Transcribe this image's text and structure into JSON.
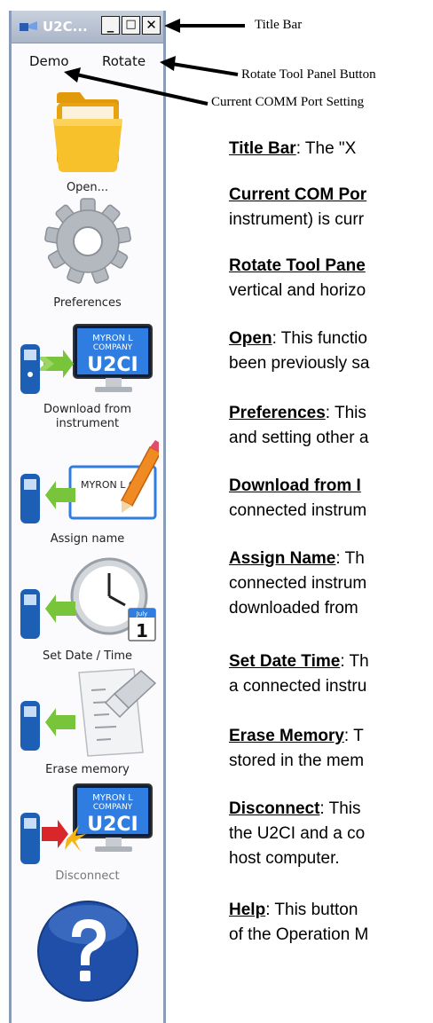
{
  "window": {
    "title": "U2C...",
    "minimize_label": "_",
    "maximize_label": "□",
    "close_label": "✕"
  },
  "menu": {
    "demo_label": "Demo",
    "rotate_label": "Rotate"
  },
  "tools": {
    "open": "Open...",
    "preferences": "Preferences",
    "download_l1": "Download from",
    "download_l2": "instrument",
    "assign": "Assign name",
    "set_date": "Set Date / Time",
    "erase": "Erase memory",
    "disconnect": "Disconnect",
    "monitor_text_1": "MYRON L",
    "monitor_text_2": "COMPANY",
    "monitor_big": "U2CI",
    "card_text": "MYRON L CO",
    "calendar_month": "July",
    "calendar_day": "1"
  },
  "callouts": {
    "title_bar": "Title Bar",
    "rotate_button": "Rotate Tool Panel Button",
    "comm_port": "Current COMM Port Setting"
  },
  "descriptions": {
    "title_bar": {
      "term": "Title Bar",
      "l1": ":  The \"X"
    },
    "com_port": {
      "term": "Current COM Por",
      "l2": "instrument) is curr"
    },
    "rotate": {
      "term": "Rotate Tool Pane",
      "l2": "vertical and horizo"
    },
    "open": {
      "term": "Open",
      "l1": ": This functio",
      "l2": "been previously sa"
    },
    "preferences": {
      "term": "Preferences",
      "l1": ":  This",
      "l2": "and setting other a"
    },
    "download": {
      "term": "Download from I",
      "l2": "connected instrum"
    },
    "assign": {
      "term": "Assign Name",
      "l1": ": Th",
      "l2": "connected instrum",
      "l3": "downloaded from"
    },
    "set_date": {
      "term": "Set Date Time",
      "l1": ": Th",
      "l2": "a connected instru"
    },
    "erase": {
      "term": "Erase Memory",
      "l1": ": T",
      "l2": "stored in the mem"
    },
    "disconnect": {
      "term": "Disconnect",
      "l1": ": This",
      "l2": "the U2CI and a co",
      "l3": "host computer."
    },
    "help": {
      "term": "Help",
      "l1": ": This button",
      "l2": "of the Operation M"
    }
  },
  "colors": {
    "accent_blue": "#1f4fa8",
    "arrow_green": "#78c43a",
    "arrow_red": "#d8262b",
    "folder_yellow": "#f5b414",
    "panel_border": "#8a9bb7"
  }
}
